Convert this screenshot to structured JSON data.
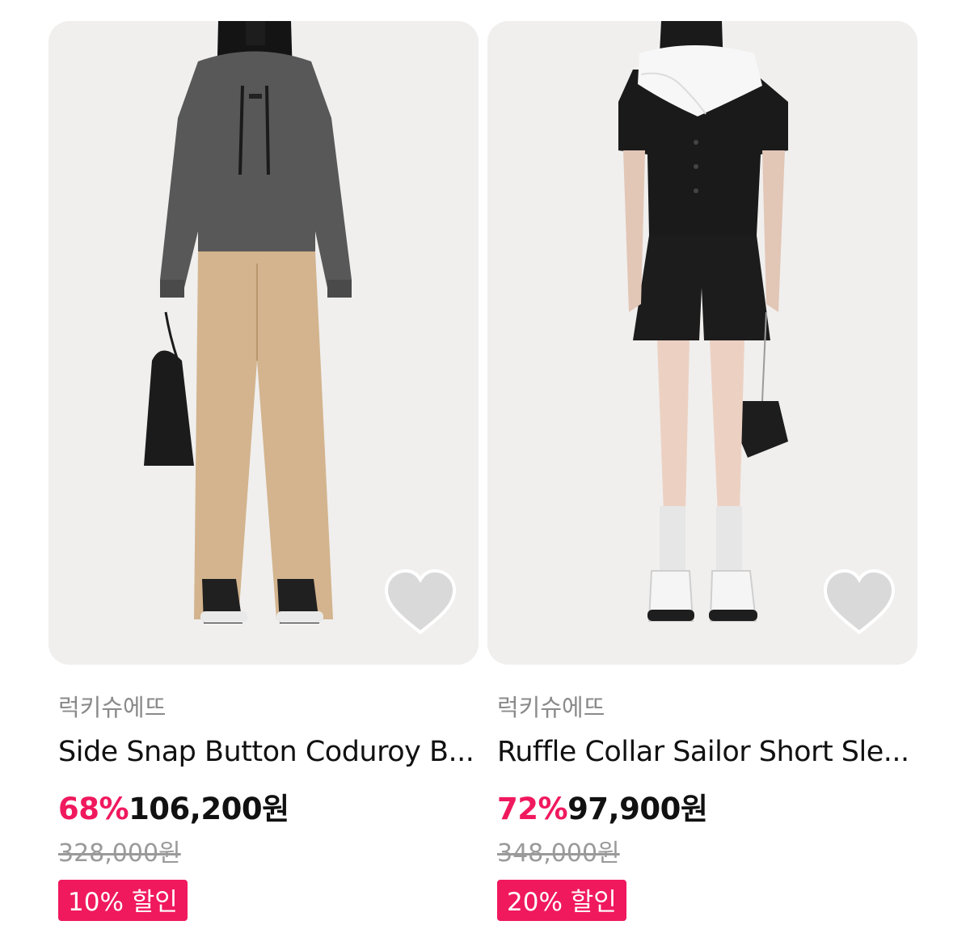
{
  "products": [
    {
      "brand": "럭키슈에뜨",
      "title": "Side Snap Button Coduroy B...",
      "discount": "68%",
      "price": "106,200원",
      "original_price": "328,000원",
      "coupon": "10% 할인",
      "wishlisted": false
    },
    {
      "brand": "럭키슈에뜨",
      "title": "Ruffle Collar Sailor Short Sle...",
      "discount": "72%",
      "price": "97,900원",
      "original_price": "348,000원",
      "coupon": "20% 할인",
      "wishlisted": false
    }
  ],
  "icons": {
    "wishlist": "heart-icon"
  },
  "colors": {
    "accent": "#f0195e",
    "heart_fill": "#d9d9d9"
  }
}
